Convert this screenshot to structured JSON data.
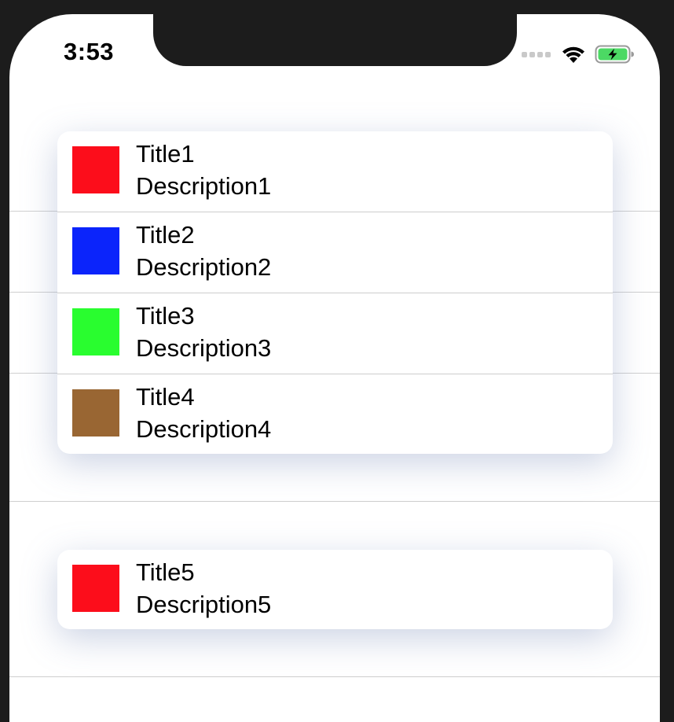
{
  "status_bar": {
    "time": "3:53",
    "icons": [
      "signal-dots-icon",
      "wifi-icon",
      "battery-charging-icon"
    ],
    "battery_color": "#4cd964"
  },
  "groups": [
    {
      "items": [
        {
          "title": "Title1",
          "description": "Description1",
          "color": "#fc0d1b"
        },
        {
          "title": "Title2",
          "description": "Description2",
          "color": "#0b24fb"
        },
        {
          "title": "Title3",
          "description": "Description3",
          "color": "#29fd2f"
        },
        {
          "title": "Title4",
          "description": "Description4",
          "color": "#996633"
        }
      ]
    },
    {
      "items": [
        {
          "title": "Title5",
          "description": "Description5",
          "color": "#fc0d1b"
        }
      ]
    }
  ]
}
